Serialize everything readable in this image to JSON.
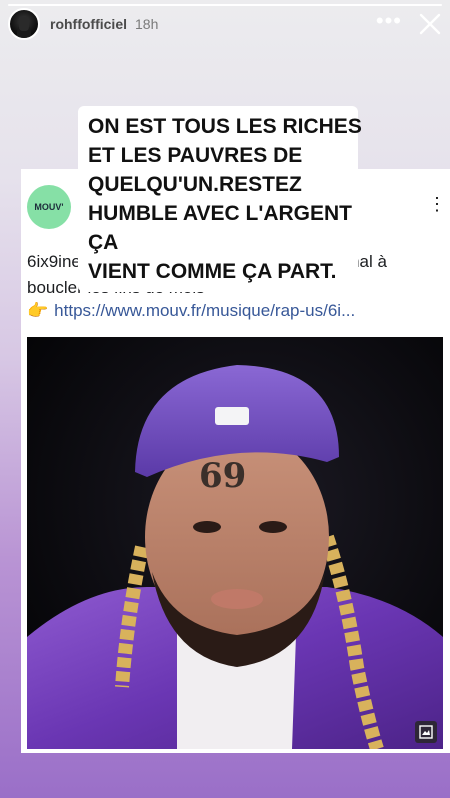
{
  "story": {
    "progress": 1.0
  },
  "header": {
    "username": "rohffofficiel",
    "time": "18h",
    "more_icon": "more-dots-icon",
    "close_icon": "close-icon"
  },
  "caption": {
    "text": "ON EST TOUS LES RICHES\nET LES PAUVRES DE\nQUELQU'UN.RESTEZ\nHUMBLE AVEC L'ARGENT ÇA\nVIENT COMME ÇA PART."
  },
  "post": {
    "logo_text": "MOUV'",
    "logo_color": "#86e0a6",
    "text": "6ix9ine révèle qu'il est fauché et qu'il a du mal à boucler les fins de mois",
    "link_icon": "👉",
    "link": "https://www.mouv.fr/musique/rap-us/6i...",
    "menu_icon": "vertical-dots-icon",
    "photo_expand_icon": "expand-image-icon"
  },
  "colors": {
    "gradient_top": "#ececee",
    "gradient_bottom": "#9a6fc8",
    "link": "#385898"
  }
}
